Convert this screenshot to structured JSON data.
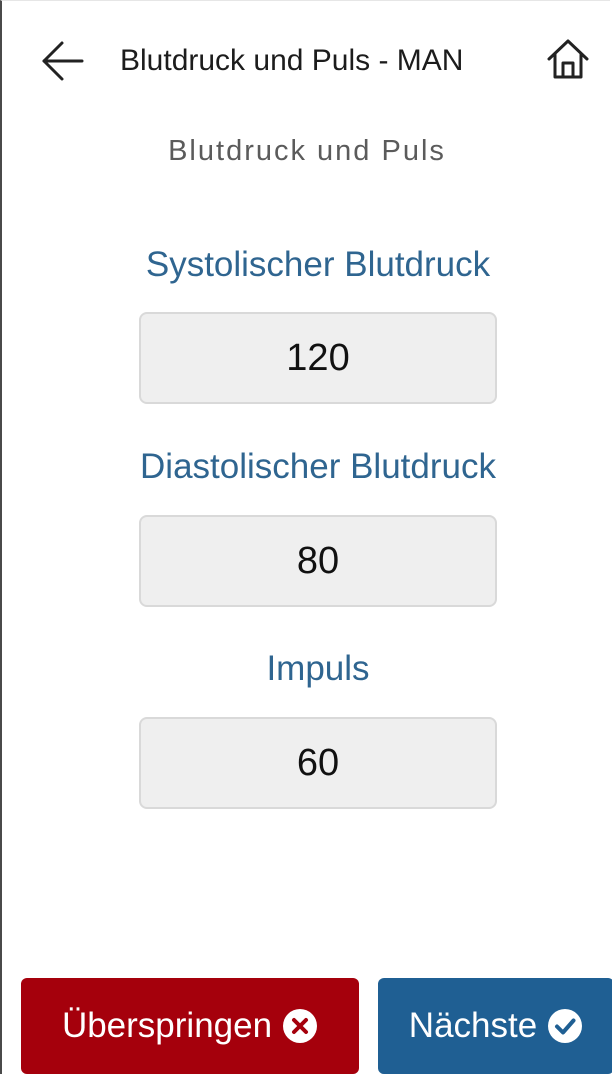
{
  "header": {
    "title": "Blutdruck und Puls - MAN",
    "back_icon": "arrow-left-icon",
    "home_icon": "home-icon"
  },
  "section_title": "Blutdruck und Puls",
  "fields": [
    {
      "label": "Systolischer Blutdruck",
      "value": "120"
    },
    {
      "label": "Diastolischer Blutdruck",
      "value": "80"
    },
    {
      "label": "Impuls",
      "value": "60"
    }
  ],
  "buttons": {
    "skip_label": "Überspringen",
    "skip_icon": "times-circle-icon",
    "next_label": "Nächste",
    "next_icon": "check-circle-icon"
  },
  "colors": {
    "label_blue": "#2f6590",
    "skip_red": "#a5000c",
    "next_blue": "#1f5f93",
    "field_bg": "#efefef"
  }
}
